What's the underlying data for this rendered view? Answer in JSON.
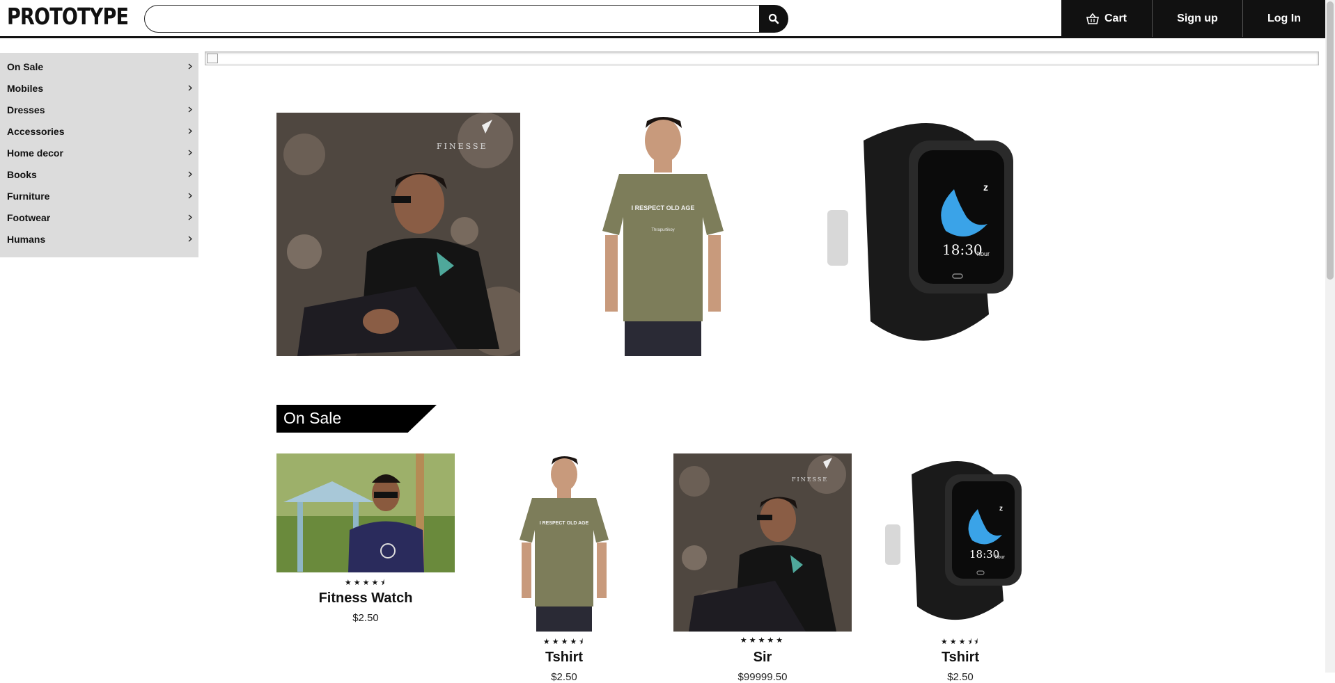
{
  "header": {
    "logo": "PROTOTYPE",
    "search": {
      "value": "",
      "placeholder": ""
    },
    "nav": {
      "cart": "Cart",
      "signup": "Sign up",
      "login": "Log In"
    }
  },
  "sidebar": {
    "items": [
      {
        "label": "On Sale"
      },
      {
        "label": "Mobiles"
      },
      {
        "label": "Dresses"
      },
      {
        "label": "Accessories"
      },
      {
        "label": "Home decor"
      },
      {
        "label": "Books"
      },
      {
        "label": "Furniture"
      },
      {
        "label": "Footwear"
      },
      {
        "label": "Humans"
      }
    ]
  },
  "featured": [
    {
      "image": "man-black-sweater-rocks"
    },
    {
      "image": "man-olive-tshirt"
    },
    {
      "image": "black-smartwatch"
    }
  ],
  "on_sale": {
    "title": "On Sale",
    "products": [
      {
        "name": "Fitness Watch",
        "price": "$2.50",
        "stars": "★★★★⯨",
        "image": "man-sunglasses-park"
      },
      {
        "name": "Tshirt",
        "price": "$2.50",
        "stars": "★★★★⯨",
        "image": "man-olive-tshirt"
      },
      {
        "name": "Sir",
        "price": "$99999.50",
        "stars": "★★★★★",
        "image": "man-black-sweater-rocks"
      },
      {
        "name": "Tshirt",
        "price": "$2.50",
        "stars": "★★★⯨⯨",
        "image": "black-smartwatch"
      }
    ]
  },
  "colors": {
    "primary": "#111111",
    "sidebar_bg": "#dcdcdc",
    "background": "#ffffff"
  }
}
